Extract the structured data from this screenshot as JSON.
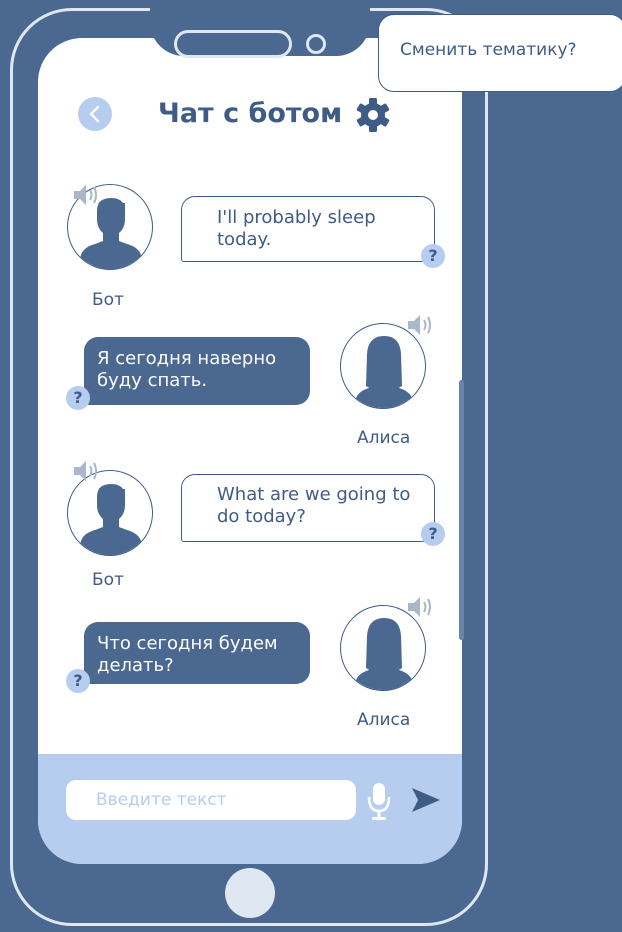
{
  "header": {
    "title": "Чат с ботом",
    "icons": {
      "back": "chevron-left-icon",
      "settings": "gear-icon"
    }
  },
  "tooltip": {
    "text": "Сменить тематику?"
  },
  "messages": [
    {
      "sender": "Бот",
      "text": "I'll probably sleep today.",
      "side": "left",
      "bubble": "outline",
      "help": "?"
    },
    {
      "sender": "Алиса",
      "text": "Я сегодня наверно буду спать.",
      "side": "right",
      "bubble": "filled",
      "help": "?"
    },
    {
      "sender": "Бот",
      "text": "What are we going to do today?",
      "side": "left",
      "bubble": "outline",
      "help": "?"
    },
    {
      "sender": "Алиса",
      "text": "Что сегодня будем делать?",
      "side": "right",
      "bubble": "filled",
      "help": "?"
    }
  ],
  "composer": {
    "placeholder": "Введите текст",
    "icons": {
      "mic": "microphone-icon",
      "send": "send-icon"
    }
  },
  "colors": {
    "background": "#4a6890",
    "accent": "#3f5c86",
    "light_accent": "#b6cdf0",
    "outline": "#dfe7f3"
  }
}
